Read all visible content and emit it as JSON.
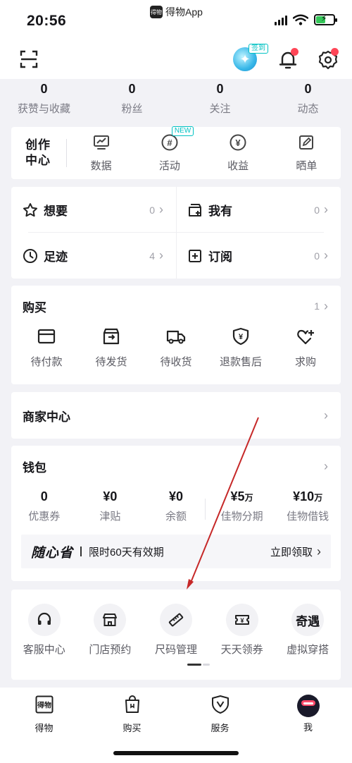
{
  "status_bar": {
    "time": "20:56",
    "app_name": "得物App",
    "app_logo_text": "得物"
  },
  "top_bar": {
    "checkin_badge": "签到"
  },
  "stats": [
    {
      "value": "0",
      "label": "获赞与收藏"
    },
    {
      "value": "0",
      "label": "粉丝"
    },
    {
      "value": "0",
      "label": "关注"
    },
    {
      "value": "0",
      "label": "动态"
    }
  ],
  "creation": {
    "title_line1": "创作",
    "title_line2": "中心",
    "new_badge": "NEW",
    "items": [
      {
        "label": "数据",
        "icon": "chart-icon"
      },
      {
        "label": "活动",
        "icon": "hashtag-icon"
      },
      {
        "label": "收益",
        "icon": "yen-icon"
      },
      {
        "label": "晒单",
        "icon": "edit-icon"
      }
    ]
  },
  "wants": {
    "want": {
      "label": "想要",
      "count": "0"
    },
    "own": {
      "label": "我有",
      "count": "0"
    },
    "history": {
      "label": "足迹",
      "count": "4"
    },
    "subscribe": {
      "label": "订阅",
      "count": "0"
    }
  },
  "buy": {
    "title": "购买",
    "count": "1",
    "items": [
      {
        "label": "待付款",
        "icon": "card-icon"
      },
      {
        "label": "待发货",
        "icon": "box-icon"
      },
      {
        "label": "待收货",
        "icon": "truck-icon"
      },
      {
        "label": "退款售后",
        "icon": "shield-yen-icon"
      },
      {
        "label": "求购",
        "icon": "heart-plus-icon"
      }
    ]
  },
  "merchant": {
    "title": "商家中心"
  },
  "wallet": {
    "title": "钱包",
    "items": [
      {
        "value": "0",
        "unit": "",
        "label": "优惠券"
      },
      {
        "value": "¥0",
        "unit": "",
        "label": "津贴"
      },
      {
        "value": "¥0",
        "unit": "",
        "label": "余额"
      },
      {
        "value": "¥5",
        "unit": "万",
        "label": "佳物分期"
      },
      {
        "value": "¥10",
        "unit": "万",
        "label": "佳物借钱"
      }
    ],
    "promo": {
      "brand": "随心省",
      "text": "限时60天有效期",
      "cta": "立即领取"
    }
  },
  "services": [
    {
      "label": "客服中心",
      "icon": "headset-icon"
    },
    {
      "label": "门店预约",
      "icon": "store-icon"
    },
    {
      "label": "尺码管理",
      "icon": "ruler-icon"
    },
    {
      "label": "天天领券",
      "icon": "ticket-icon"
    },
    {
      "label": "虚拟穿搭",
      "icon_text": "奇遇"
    }
  ],
  "tabs": [
    {
      "label": "得物",
      "icon": "dewu-logo-icon"
    },
    {
      "label": "购买",
      "icon": "shopping-bag-icon"
    },
    {
      "label": "服务",
      "icon": "service-shield-icon"
    },
    {
      "label": "我",
      "icon": "avatar"
    }
  ],
  "colors": {
    "accent": "#01c2c3",
    "red_dot": "#ff4657",
    "annotation_arrow": "#c62828",
    "background": "#f2f2f6"
  }
}
